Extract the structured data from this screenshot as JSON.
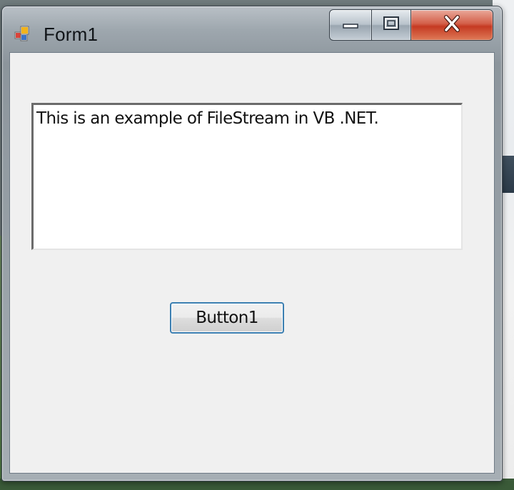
{
  "window": {
    "title": "Form1",
    "title_icon": "form-app-icon",
    "caption_buttons": {
      "minimize_icon": "minimize-icon",
      "maximize_icon": "maximize-icon",
      "close_icon": "close-icon"
    },
    "close_color": "#c53a22"
  },
  "form": {
    "textbox_value": "This is an example of FileStream in VB .NET.",
    "button_label": "Button1"
  }
}
